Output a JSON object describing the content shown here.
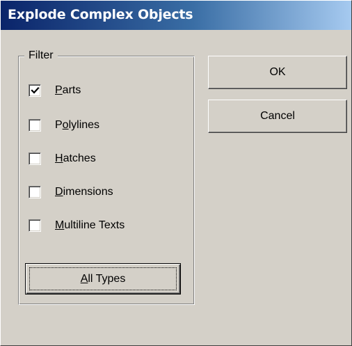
{
  "window": {
    "title": "Explode Complex Objects"
  },
  "filter": {
    "legend": "Filter",
    "items": [
      {
        "label_accel": "P",
        "label_rest": "arts",
        "checked": true
      },
      {
        "label_pre": "P",
        "label_accel": "o",
        "label_rest": "lylines",
        "checked": false
      },
      {
        "label_accel": "H",
        "label_rest": "atches",
        "checked": false
      },
      {
        "label_accel": "D",
        "label_rest": "imensions",
        "checked": false
      },
      {
        "label_accel": "M",
        "label_rest": "ultiline Texts",
        "checked": false
      }
    ],
    "all_types": {
      "accel": "A",
      "rest": "ll Types"
    }
  },
  "buttons": {
    "ok": "OK",
    "cancel": "Cancel"
  },
  "colors": {
    "face": "#d4d0c8",
    "title_start": "#0a246a",
    "title_end": "#a6caf0"
  }
}
